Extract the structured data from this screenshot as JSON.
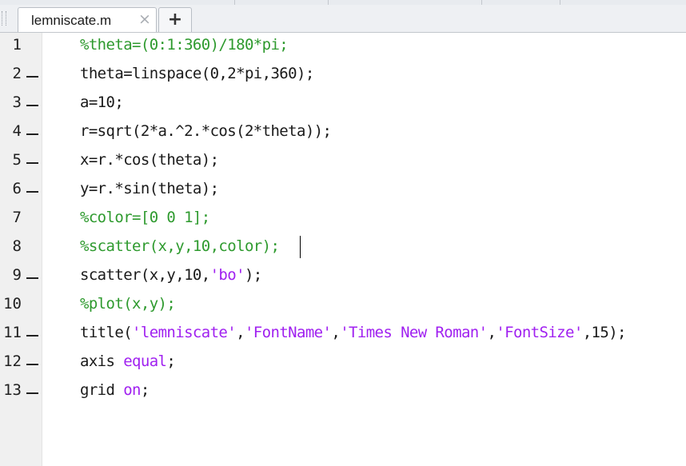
{
  "tab": {
    "filename": "lemniscate.m",
    "close_glyph": "×",
    "add_glyph": "+"
  },
  "editor": {
    "lines": [
      {
        "num": "1",
        "breakpoint": false,
        "segments": [
          {
            "t": "%theta=(0:1:360)/180*pi;",
            "c": "comment"
          }
        ]
      },
      {
        "num": "2",
        "breakpoint": true,
        "segments": [
          {
            "t": "theta=linspace(0,2*pi,360);",
            "c": "code"
          }
        ]
      },
      {
        "num": "3",
        "breakpoint": true,
        "segments": [
          {
            "t": "a=10;",
            "c": "code"
          }
        ]
      },
      {
        "num": "4",
        "breakpoint": true,
        "segments": [
          {
            "t": "r=sqrt(2*a.^2.*cos(2*theta));",
            "c": "code"
          }
        ]
      },
      {
        "num": "5",
        "breakpoint": true,
        "segments": [
          {
            "t": "x=r.*cos(theta);",
            "c": "code"
          }
        ]
      },
      {
        "num": "6",
        "breakpoint": true,
        "segments": [
          {
            "t": "y=r.*sin(theta);",
            "c": "code"
          }
        ]
      },
      {
        "num": "7",
        "breakpoint": false,
        "segments": [
          {
            "t": "%color=[0 0 1];",
            "c": "comment"
          }
        ]
      },
      {
        "num": "8",
        "breakpoint": false,
        "segments": [
          {
            "t": "%scatter(x,y,10,color);",
            "c": "comment"
          }
        ]
      },
      {
        "num": "9",
        "breakpoint": true,
        "segments": [
          {
            "t": "scatter(x,y,10,",
            "c": "code"
          },
          {
            "t": "'bo'",
            "c": "string"
          },
          {
            "t": ");",
            "c": "code"
          }
        ]
      },
      {
        "num": "10",
        "breakpoint": false,
        "segments": [
          {
            "t": "%plot(x,y);",
            "c": "comment"
          }
        ]
      },
      {
        "num": "11",
        "breakpoint": true,
        "segments": [
          {
            "t": "title(",
            "c": "code"
          },
          {
            "t": "'lemniscate'",
            "c": "string"
          },
          {
            "t": ",",
            "c": "code"
          },
          {
            "t": "'FontName'",
            "c": "string"
          },
          {
            "t": ",",
            "c": "code"
          },
          {
            "t": "'Times New Roman'",
            "c": "string"
          },
          {
            "t": ",",
            "c": "code"
          },
          {
            "t": "'FontSize'",
            "c": "string"
          },
          {
            "t": ",15);",
            "c": "code"
          }
        ]
      },
      {
        "num": "12",
        "breakpoint": true,
        "segments": [
          {
            "t": "axis ",
            "c": "code"
          },
          {
            "t": "equal",
            "c": "keyword"
          },
          {
            "t": ";",
            "c": "code"
          }
        ]
      },
      {
        "num": "13",
        "breakpoint": true,
        "segments": [
          {
            "t": "grid ",
            "c": "code"
          },
          {
            "t": "on",
            "c": "keyword"
          },
          {
            "t": ";",
            "c": "code"
          }
        ]
      }
    ]
  },
  "colors": {
    "comment": "#2e9a2e",
    "string": "#a020f0",
    "keyword": "#a020f0",
    "code": "#1a1a1a"
  }
}
